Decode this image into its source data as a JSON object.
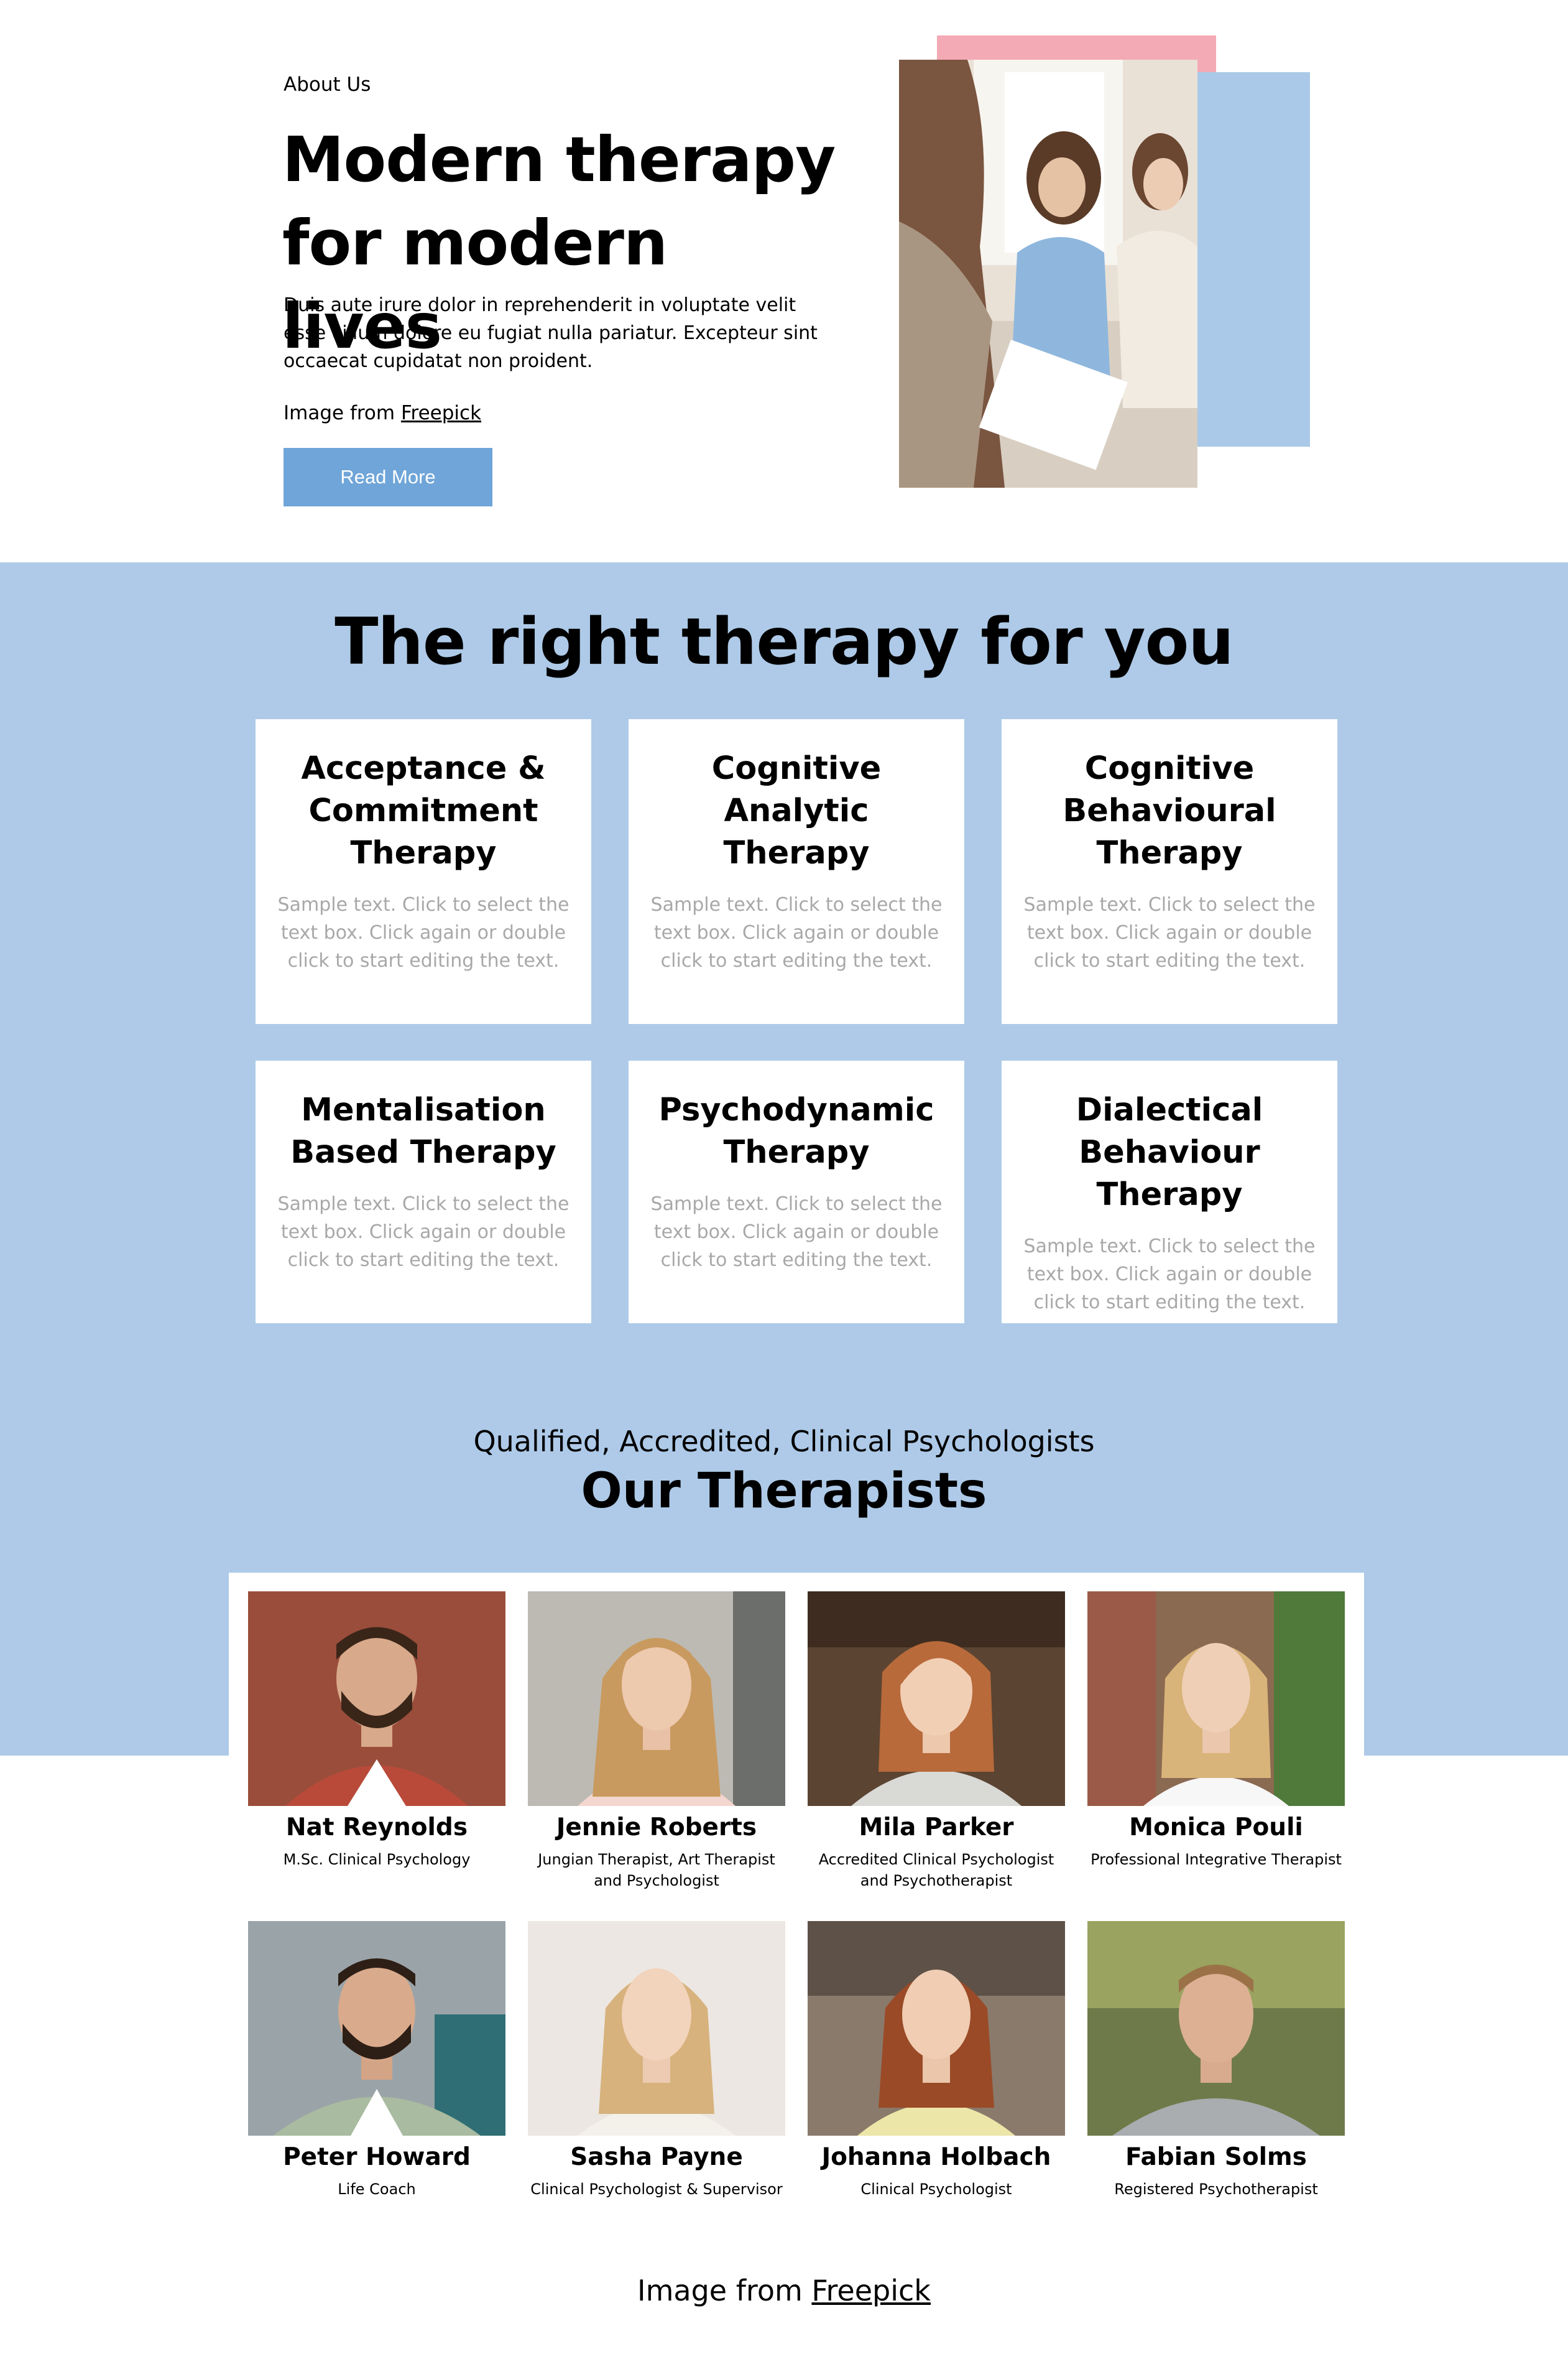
{
  "about": {
    "label": "About Us",
    "title_line1": "Modern therapy",
    "title_line2": "for modern lives",
    "text": "Duis aute irure dolor in reprehenderit in voluptate velit esse cillum dolore eu fugiat nulla pariatur. Excepteur sint occaecat cupidatat non proident.",
    "credit_prefix": "Image from",
    "credit_link": "Freepick",
    "button": "Read More"
  },
  "therapies": {
    "title": "The right therapy for you",
    "cards": [
      {
        "title": "Acceptance & Commitment Therapy",
        "text": "Sample text. Click to select the text box. Click again or double click to start editing the text."
      },
      {
        "title": "Cognitive Analytic Therapy",
        "text": "Sample text. Click to select the text box. Click again or double click to start editing the text."
      },
      {
        "title": "Cognitive Behavioural Therapy",
        "text": "Sample text. Click to select the text box. Click again or double click to start editing the text."
      },
      {
        "title": "Mentalisation Based Therapy",
        "text": "Sample text. Click to select the text box. Click again or double click to start editing the text."
      },
      {
        "title": "Psychodynamic Therapy",
        "text": "Sample text. Click to select the text box. Click again or double click to start editing the text."
      },
      {
        "title": "Dialectical Behaviour Therapy",
        "text": "Sample text. Click to select the text box. Click again or double click to start editing the text."
      }
    ]
  },
  "team": {
    "subtitle": "Qualified, Accredited, Clinical Psychologists",
    "title": "Our Therapists",
    "members": [
      {
        "name": "Nat Reynolds",
        "role": "M.Sc. Clinical Psychology"
      },
      {
        "name": "Jennie Roberts",
        "role": "Jungian Therapist, Art Therapist and Psychologist"
      },
      {
        "name": "Mila Parker",
        "role": "Accredited Clinical Psychologist and Psychotherapist"
      },
      {
        "name": "Monica Pouli",
        "role": "Professional Integrative Therapist"
      },
      {
        "name": "Peter Howard",
        "role": "Life Coach"
      },
      {
        "name": "Sasha Payne",
        "role": "Clinical Psychologist & Supervisor"
      },
      {
        "name": "Johanna Holbach",
        "role": "Clinical Psychologist"
      },
      {
        "name": "Fabian Solms",
        "role": "Registered Psychotherapist"
      }
    ]
  },
  "footer": {
    "credit_prefix": "Image from",
    "credit_link": "Freepick"
  },
  "colors": {
    "accent_blue": "#aecae8",
    "button_blue": "#6fa5d8",
    "accent_pink": "#f4aab4",
    "muted_text": "#a8a8a8"
  }
}
